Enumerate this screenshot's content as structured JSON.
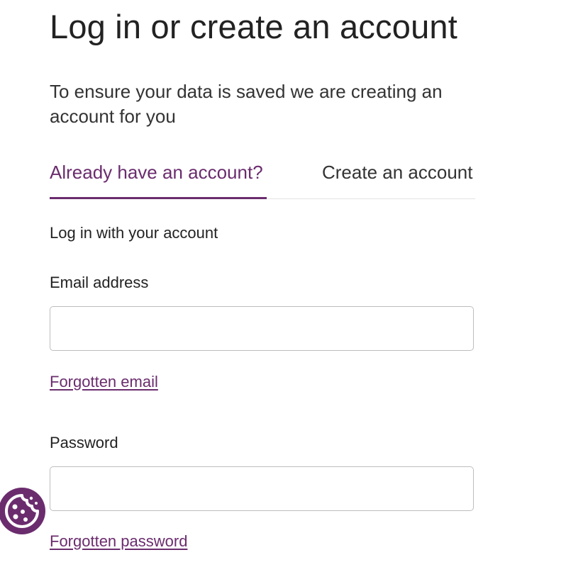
{
  "title": "Log in or create an account",
  "intro": "To ensure your data is saved we are creating an account for you",
  "tabs": [
    {
      "label": "Already have an account?",
      "active": true
    },
    {
      "label": "Create an account",
      "active": false
    }
  ],
  "login_form": {
    "heading": "Log in with your account",
    "email_label": "Email address",
    "email_value": "",
    "forgotten_email_link": "Forgotten email",
    "password_label": "Password",
    "password_value": "",
    "forgotten_password_link": "Forgotten password"
  },
  "cookie_button": {
    "icon": "cookie-icon"
  },
  "colors": {
    "accent": "#6b2c6e",
    "text": "#222222",
    "input_border": "#bdbdbd"
  }
}
